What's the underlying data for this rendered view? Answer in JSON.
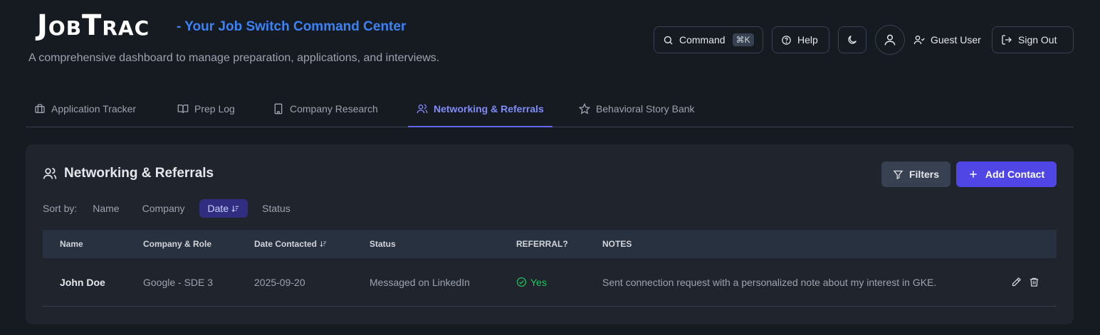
{
  "header": {
    "logo_first": "J",
    "logo_mid": "OB",
    "logo_t": "T",
    "logo_rest": "RAC",
    "tagline": "- Your Job Switch Command Center",
    "subtitle": "A comprehensive dashboard to manage preparation, applications, and interviews.",
    "command_label": "Command",
    "command_shortcut": "⌘K",
    "help_label": "Help",
    "user_label": "Guest User",
    "signout_label": "Sign Out"
  },
  "tabs": [
    {
      "label": "Application Tracker",
      "icon": "briefcase-icon"
    },
    {
      "label": "Prep Log",
      "icon": "book-icon"
    },
    {
      "label": "Company Research",
      "icon": "building-icon"
    },
    {
      "label": "Networking & Referrals",
      "icon": "users-icon",
      "active": true
    },
    {
      "label": "Behavioral Story Bank",
      "icon": "star-icon"
    }
  ],
  "card": {
    "title": "Networking & Referrals",
    "filters_label": "Filters",
    "add_label": "Add Contact",
    "sort_label": "Sort by:",
    "sort_options": [
      "Name",
      "Company",
      "Date",
      "Status"
    ],
    "sort_active": "Date",
    "columns": [
      "Name",
      "Company & Role",
      "Date Contacted",
      "Status",
      "REFERRAL?",
      "NOTES"
    ],
    "rows": [
      {
        "name": "John Doe",
        "company_role": "Google - SDE 3",
        "date": "2025-09-20",
        "status": "Messaged on LinkedIn",
        "referral": "Yes",
        "notes": "Sent connection request with a personalized note about my interest in GKE."
      }
    ]
  },
  "colors": {
    "accent": "#4f46e5",
    "tagline": "#3b82f6",
    "referral_yes": "#22c55e"
  }
}
